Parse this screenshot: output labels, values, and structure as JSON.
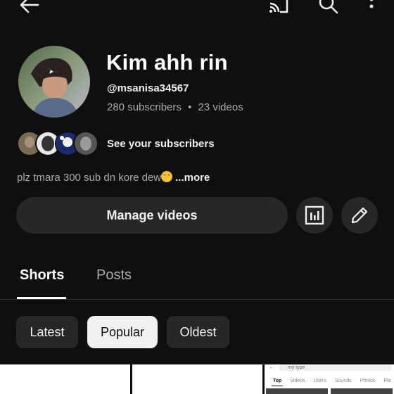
{
  "topbar": {
    "icons": [
      "back-arrow-icon",
      "cast-icon",
      "search-icon",
      "more-vert-icon"
    ]
  },
  "channel": {
    "name": "Kim ahh rin",
    "handle": "@msanisa34567",
    "subscribers": "280 subscribers",
    "separator": "•",
    "videos": "23 videos"
  },
  "subscribers_row": {
    "label": "See your subscribers"
  },
  "description": {
    "text": "plz tmara 300 sub dn kore dew",
    "more": "...more"
  },
  "actions": {
    "manage_label": "Manage videos",
    "analytics_icon": "analytics-icon",
    "edit_icon": "pencil-icon"
  },
  "tabs": [
    {
      "label": "Shorts",
      "active": true
    },
    {
      "label": "Posts",
      "active": false
    }
  ],
  "chips": [
    {
      "label": "Latest",
      "selected": false
    },
    {
      "label": "Popular",
      "selected": true
    },
    {
      "label": "Oldest",
      "selected": false
    }
  ],
  "thumbnail_preview": {
    "search_text": "my type",
    "tabs": [
      "Top",
      "Videos",
      "Users",
      "Sounds",
      "Photos",
      "Pla"
    ]
  },
  "colors": {
    "background": "#0f0f0f",
    "surface": "#272727",
    "text_primary": "#f1f1f1",
    "text_secondary": "#aaaaaa"
  }
}
